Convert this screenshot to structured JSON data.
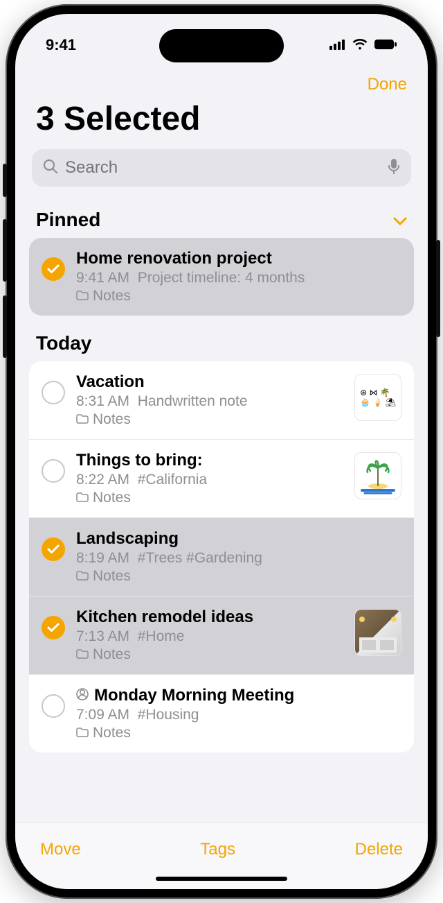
{
  "status": {
    "time": "9:41"
  },
  "nav": {
    "done": "Done"
  },
  "title": "3 Selected",
  "search": {
    "placeholder": "Search"
  },
  "sections": {
    "pinned": {
      "label": "Pinned"
    },
    "today": {
      "label": "Today"
    }
  },
  "pinned_items": [
    {
      "title": "Home renovation project",
      "time": "9:41 AM",
      "preview": "Project timeline: 4 months",
      "folder": "Notes",
      "selected": true
    }
  ],
  "today_items": [
    {
      "title": "Vacation",
      "time": "8:31 AM",
      "preview": "Handwritten note",
      "folder": "Notes",
      "selected": false,
      "thumb": "doodles"
    },
    {
      "title": "Things to bring:",
      "time": "8:22 AM",
      "preview": "#California",
      "folder": "Notes",
      "selected": false,
      "thumb": "palm"
    },
    {
      "title": "Landscaping",
      "time": "8:19 AM",
      "preview": "#Trees #Gardening",
      "folder": "Notes",
      "selected": true
    },
    {
      "title": "Kitchen remodel ideas",
      "time": "7:13 AM",
      "preview": "#Home",
      "folder": "Notes",
      "selected": true,
      "thumb": "kitchen"
    },
    {
      "title": "Monday Morning Meeting",
      "time": "7:09 AM",
      "preview": "#Housing",
      "folder": "Notes",
      "selected": false,
      "shared": true
    }
  ],
  "toolbar": {
    "move": "Move",
    "tags": "Tags",
    "delete": "Delete"
  }
}
